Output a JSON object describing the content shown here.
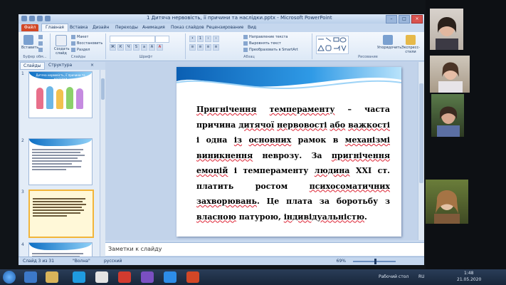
{
  "window": {
    "title": "1 Дитяча нервовість, її причини та наслідки.pptx - Microsoft PowerPoint"
  },
  "ribbon": {
    "file_tab": "Файл",
    "tabs": [
      "Главная",
      "Вставка",
      "Дизайн",
      "Переходы",
      "Анимация",
      "Показ слайдов",
      "Рецензирование",
      "Вид"
    ],
    "clipboard": {
      "paste": "Вставить",
      "label": "Буфер обм..."
    },
    "slides": {
      "new_slide": "Создать слайд",
      "layout": "Макет",
      "reset": "Восстановить",
      "section": "Раздел",
      "label": "Слайды"
    },
    "font": {
      "label": "Шрифт"
    },
    "paragraph": {
      "direction": "Направление текста",
      "align": "Выровнять текст",
      "smartart": "Преобразовать в SmartArt",
      "label": "Абзац"
    },
    "drawing": {
      "arrange": "Упорядочить",
      "quick_styles": "Экспресс-стили",
      "label": "Рисование"
    }
  },
  "left_panel": {
    "tabs": [
      "Слайды",
      "Структура"
    ],
    "slide_numbers": [
      "1",
      "2",
      "3",
      "4"
    ],
    "thumb1_title": "Дитяча нервовість, її причини та наслідки"
  },
  "slide": {
    "paragraph": [
      {
        "t": "Пригнічення",
        "r": true
      },
      {
        "t": " ",
        "r": false
      },
      {
        "t": "темпераменту",
        "r": true
      },
      {
        "t": " – часта причина ",
        "r": false
      },
      {
        "t": "дитячої",
        "r": true
      },
      {
        "t": " ",
        "r": false
      },
      {
        "t": "нервовості",
        "r": true
      },
      {
        "t": " ",
        "r": false
      },
      {
        "t": "або",
        "r": true
      },
      {
        "t": " ",
        "r": false
      },
      {
        "t": "важкості",
        "r": true
      },
      {
        "t": " і одна ",
        "r": false
      },
      {
        "t": "із",
        "r": true
      },
      {
        "t": " ",
        "r": false
      },
      {
        "t": "основних",
        "r": true
      },
      {
        "t": " рамок в ",
        "r": false
      },
      {
        "t": "механізмі",
        "r": true
      },
      {
        "t": " ",
        "r": false
      },
      {
        "t": "виникнення",
        "r": true
      },
      {
        "t": " неврозу. За ",
        "r": false
      },
      {
        "t": "пригнічення",
        "r": true
      },
      {
        "t": " ",
        "r": false
      },
      {
        "t": "емоцій",
        "r": true
      },
      {
        "t": " і темпераменту ",
        "r": false
      },
      {
        "t": "людина",
        "r": true
      },
      {
        "t": " XXI ст. платить ростом ",
        "r": false
      },
      {
        "t": "психосоматичних",
        "r": true
      },
      {
        "t": " ",
        "r": false
      },
      {
        "t": "захворювань",
        "r": true
      },
      {
        "t": ". Це плата за боротьбу з ",
        "r": false
      },
      {
        "t": "власною",
        "r": true
      },
      {
        "t": " патурою, ",
        "r": false
      },
      {
        "t": "індивідуальністю",
        "r": true
      },
      {
        "t": ".",
        "r": false
      }
    ]
  },
  "notes": {
    "placeholder": "Заметки к слайду"
  },
  "status": {
    "slide_of": "Слайд 3 из 31",
    "theme": "\"Волна\"",
    "language": "русский",
    "zoom": "69%"
  },
  "taskbar": {
    "desktop": "Рабочий стол",
    "lang": "RU",
    "time": "1:48",
    "date": "21.05.2020"
  },
  "colors": {
    "accent": "#0d6fc4",
    "selected_thumb": "#f2b53a",
    "spell_underline": "#dd2233"
  }
}
